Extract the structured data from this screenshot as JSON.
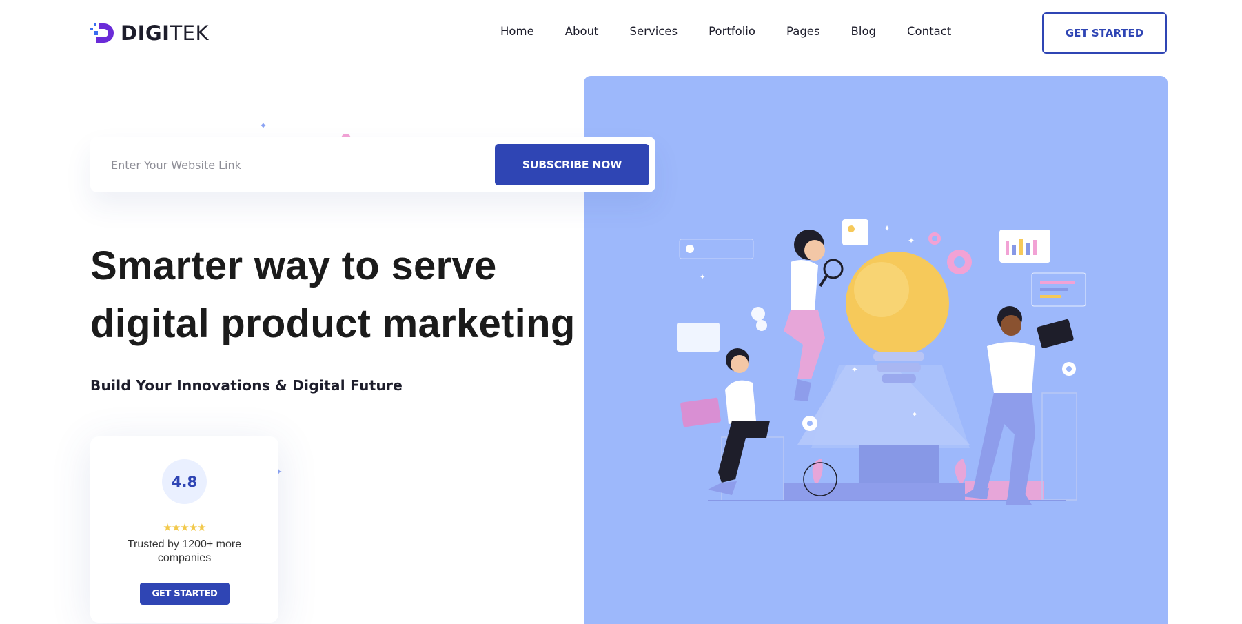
{
  "brand": {
    "name_bold": "DIGI",
    "name_light": "TEK"
  },
  "nav": {
    "items": [
      "Home",
      "About",
      "Services",
      "Portfolio",
      "Pages",
      "Blog",
      "Contact"
    ]
  },
  "header": {
    "cta_label": "GET STARTED"
  },
  "subscribe": {
    "placeholder": "Enter Your Website Link",
    "button_label": "SUBSCRIBE NOW"
  },
  "hero": {
    "headline": "Smarter way to serve digital product marketing",
    "subheadline": "Build Your Innovations & Digital Future"
  },
  "rating_card": {
    "rating": "4.8",
    "stars": "★★★★★",
    "trusted_text": "Trusted by 1200+ more companies",
    "button_label": "GET STARTED"
  },
  "colors": {
    "primary": "#2f45b4",
    "hero_panel": "#9db8fb",
    "star": "#f2c94c"
  }
}
